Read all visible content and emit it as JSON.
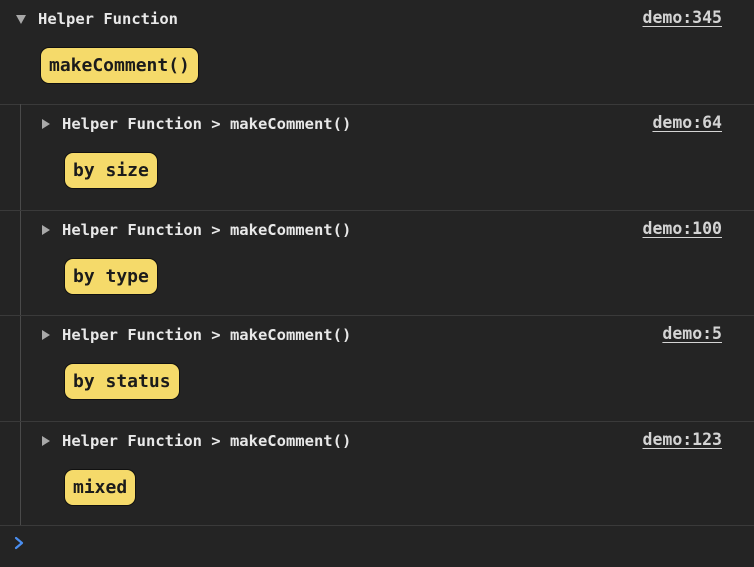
{
  "root_group": {
    "header": "Helper Function",
    "source": "demo:345",
    "badge": "makeComment()"
  },
  "groups": [
    {
      "header": "Helper Function > makeComment()",
      "source": "demo:64",
      "badge": "by size"
    },
    {
      "header": "Helper Function > makeComment()",
      "source": "demo:100",
      "badge": "by type"
    },
    {
      "header": "Helper Function > makeComment()",
      "source": "demo:5",
      "badge": "by status"
    },
    {
      "header": "Helper Function > makeComment()",
      "source": "demo:123",
      "badge": "mixed"
    }
  ],
  "colors": {
    "background": "#242424",
    "badge_bg": "#f5da6a",
    "prompt": "#4a8ef0"
  },
  "icons": {
    "expanded": "triangle-down-icon",
    "collapsed": "triangle-right-icon",
    "prompt": "chevron-right-icon"
  }
}
